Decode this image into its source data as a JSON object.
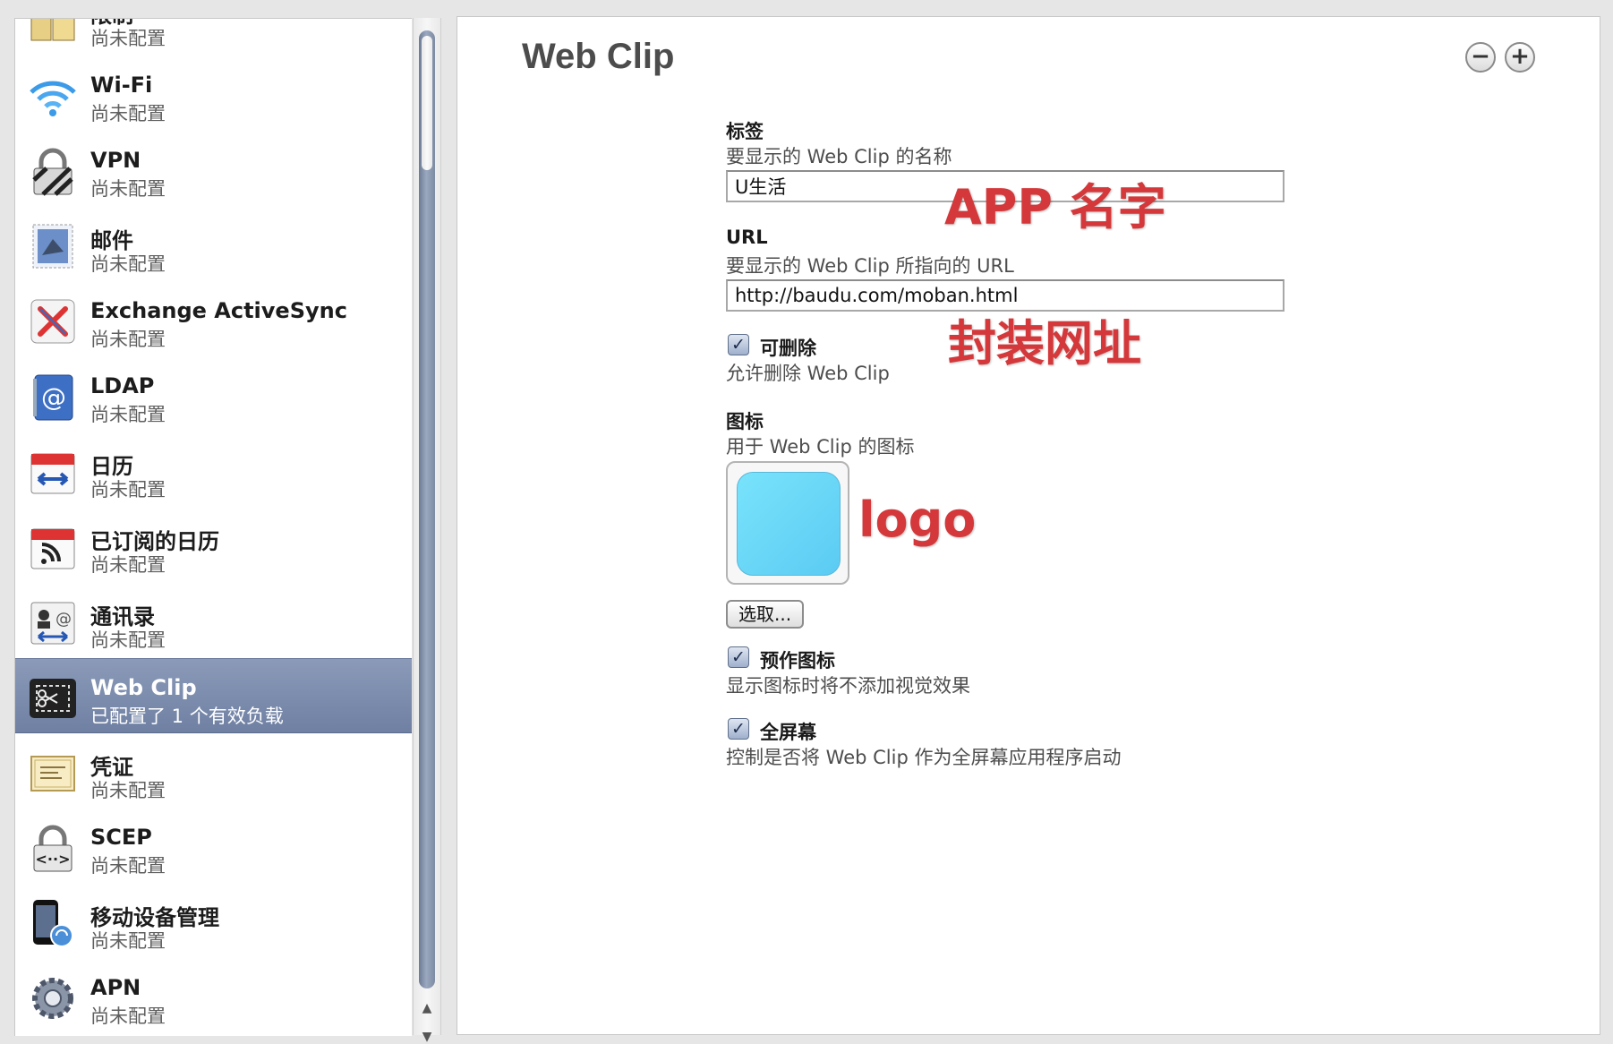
{
  "sidebar": {
    "items": [
      {
        "icon": "lock-restrictions-icon",
        "title": "限制",
        "subtitle": "尚未配置"
      },
      {
        "icon": "wifi-icon",
        "title": "Wi-Fi",
        "subtitle": "尚未配置"
      },
      {
        "icon": "vpn-lock-icon",
        "title": "VPN",
        "subtitle": "尚未配置"
      },
      {
        "icon": "mail-stamp-icon",
        "title": "邮件",
        "subtitle": "尚未配置"
      },
      {
        "icon": "exchange-icon",
        "title": "Exchange ActiveSync",
        "subtitle": "尚未配置"
      },
      {
        "icon": "ldap-address-book-icon",
        "title": "LDAP",
        "subtitle": "尚未配置"
      },
      {
        "icon": "calendar-sync-icon",
        "title": "日历",
        "subtitle": "尚未配置"
      },
      {
        "icon": "calendar-subscription-icon",
        "title": "已订阅的日历",
        "subtitle": "尚未配置"
      },
      {
        "icon": "contacts-sync-icon",
        "title": "通讯录",
        "subtitle": "尚未配置"
      },
      {
        "icon": "web-clip-scissors-icon",
        "title": "Web Clip",
        "subtitle": "已配置了 1 个有效负载",
        "selected": true
      },
      {
        "icon": "certificate-icon",
        "title": "凭证",
        "subtitle": "尚未配置"
      },
      {
        "icon": "scep-lock-icon",
        "title": "SCEP",
        "subtitle": "尚未配置"
      },
      {
        "icon": "mobile-device-management-icon",
        "title": "移动设备管理",
        "subtitle": "尚未配置"
      },
      {
        "icon": "apn-gear-icon",
        "title": "APN",
        "subtitle": "尚未配置"
      }
    ]
  },
  "main": {
    "title": "Web Clip",
    "remove_button": "−",
    "add_button": "+",
    "label_field": {
      "label": "标签",
      "description": "要显示的 Web Clip 的名称",
      "value": "U生活"
    },
    "url_field": {
      "label": "URL",
      "description": "要显示的 Web Clip 所指向的 URL",
      "value": "http://baudu.com/moban.html"
    },
    "removable": {
      "checked": true,
      "label": "可删除",
      "description": "允许删除 Web Clip"
    },
    "icon_field": {
      "label": "图标",
      "description": "用于 Web Clip 的图标",
      "choose_button": "选取..."
    },
    "precomposed": {
      "checked": true,
      "label": "预作图标",
      "description": "显示图标时将不添加视觉效果"
    },
    "fullscreen": {
      "checked": true,
      "label": "全屏幕",
      "description": "控制是否将 Web Clip 作为全屏幕应用程序启动"
    }
  },
  "annotations": {
    "app_name": "APP 名字",
    "wrapped_url": "封装网址",
    "logo": "logo"
  },
  "colors": {
    "selection": "#7a8bab",
    "annotation": "#d4383a",
    "icon_fill": "#6fd9f8"
  }
}
